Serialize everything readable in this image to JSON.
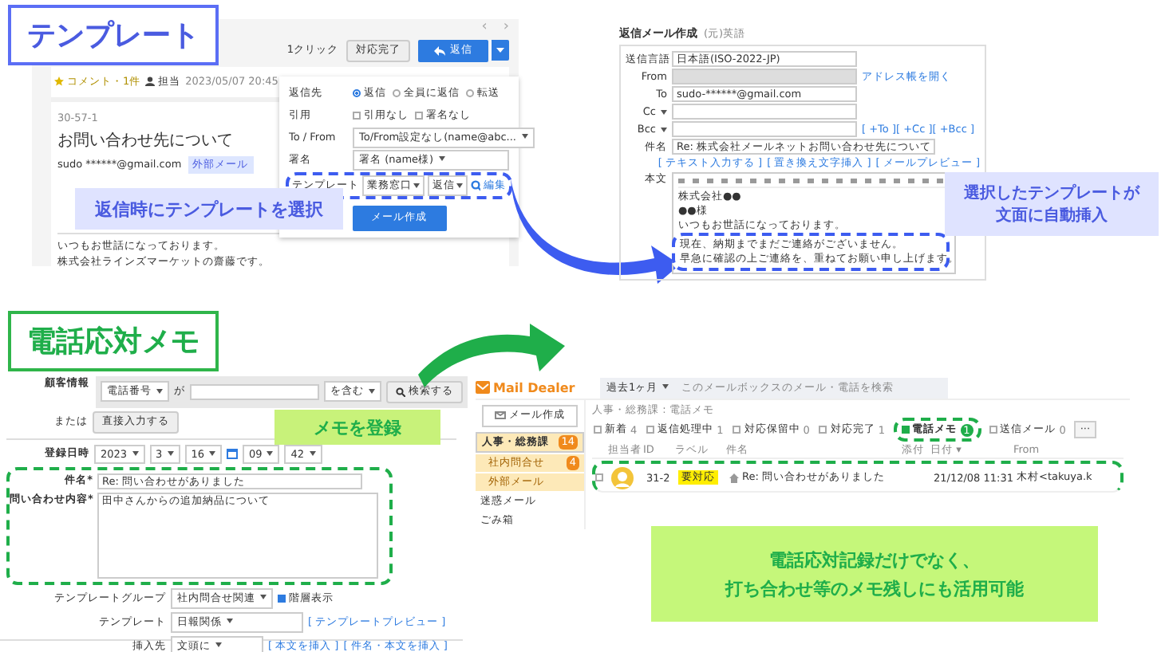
{
  "template_section": {
    "heading": "テンプレート",
    "reply_screen": {
      "nav": [
        "‹",
        "›"
      ],
      "one_click": "1クリック",
      "done_button": "対応完了",
      "reply_button": "返信",
      "comment": "コメント・1件",
      "assignee": "担当",
      "date": "2023/05/07 20:45",
      "mail_id": "30-57-1",
      "subject": "お問い合わせ先について",
      "sender": "sudo ******@gmail.com",
      "tag": "外部メール",
      "body": [
        "いつもお世話になっております。",
        "株式会社ラインズマーケットの齋藤です。"
      ],
      "reply_menu": {
        "rows": [
          {
            "label": "返信先",
            "kind": "radio",
            "options": [
              {
                "label": "返信",
                "selected": true
              },
              {
                "label": "全員に返信",
                "selected": false
              },
              {
                "label": "転送",
                "selected": false
              }
            ]
          },
          {
            "label": "引用",
            "kind": "check",
            "options": [
              {
                "label": "引用なし",
                "checked": false
              },
              {
                "label": "署名なし",
                "checked": false
              }
            ]
          },
          {
            "label": "To / From",
            "kind": "select",
            "value": "To/From設定なし(name@abc..."
          },
          {
            "label": "署名",
            "kind": "select",
            "value": "署名 (name様)"
          },
          {
            "label": "テンプレート",
            "kind": "template",
            "values": [
              "業務窓口",
              "返信"
            ],
            "edit": "編集"
          }
        ],
        "create_button": "メール作成"
      }
    },
    "reply_callout": "返信時にテンプレートを選択",
    "compose_screen": {
      "title": "返信メール作成",
      "subtitle": "(元)英語",
      "fields": [
        {
          "label": "送信言語",
          "value": "日本語(ISO-2022-JP)"
        },
        {
          "label": "From"
        },
        {
          "label": "To",
          "value": "sudo-******@gmail.com"
        },
        {
          "label": "Cc"
        },
        {
          "label": "Bcc"
        },
        {
          "label": "件名",
          "value": "Re: 株式会社メールネットお問い合わせ先について"
        }
      ],
      "address_link": "アドレス帳を開く",
      "cc_links": "[ +To ][ +Cc ][ +Bcc ]",
      "body_links": [
        "[ テキスト入力する ]",
        "[ 置き換え文字挿入 ]",
        "[ メールプレビュー ]"
      ],
      "body_label": "本文",
      "body_lines": [
        "株式会社●●",
        "●●様",
        "いつもお世話になっております。",
        "現在、納期までまだご連絡がございません。",
        "早急に確認の上ご連絡を、重ねてお願い申し上げます。"
      ]
    },
    "compose_callout": [
      "選択したテンプレートが",
      "文面に自動挿入"
    ]
  },
  "phone_memo_section": {
    "heading": "電話応対メモ",
    "memo_form": {
      "customer_label": "顧客情報",
      "search_field": "電話番号",
      "ga": "が",
      "match": "を含む",
      "search_button": "検索する",
      "or": "または",
      "direct_button": "直接入力する",
      "date_label": "登録日時",
      "date_parts": [
        "2023",
        "3",
        "16",
        "09",
        "42"
      ],
      "subject_label": "件名*",
      "subject": "Re: 問い合わせがありました",
      "content_label": "問い合わせ内容*",
      "content": "田中さんからの追加納品について",
      "group_label": "テンプレートグループ",
      "group": "社内問合せ関連",
      "hierarchy": {
        "label": "階層表示",
        "checked": true
      },
      "template_label": "テンプレート",
      "template": "日報関係",
      "preview_link": "[ テンプレートプレビュー ]",
      "insert_label": "挿入先",
      "insert": "文頭に",
      "insert_links": [
        "[ 本文を挿入 ]",
        "[ 件名・本文を挿入 ]"
      ]
    },
    "memo_callout": "メモを登録",
    "mail_app": {
      "logo": "Mail Dealer",
      "period": "過去1ヶ月",
      "search_placeholder": "このメールボックスのメール・電話を検索",
      "compose_button": "メール作成",
      "folders": [
        {
          "label": "人事・総務課",
          "count": "14",
          "selected": true,
          "children": [
            {
              "label": "社内問合せ",
              "count": "4",
              "selected": false
            },
            {
              "label": "外部メール",
              "selected": false
            }
          ]
        },
        {
          "label": "迷惑メール",
          "selected": false
        },
        {
          "label": "ごみ箱",
          "selected": false
        }
      ],
      "breadcrumb": "人事・総務課 : 電話メモ",
      "filters": [
        {
          "label": "新着",
          "count": "4",
          "selected": false
        },
        {
          "label": "返信処理中",
          "count": "1",
          "selected": false
        },
        {
          "label": "対応保留中",
          "count": "0",
          "selected": false
        },
        {
          "label": "対応完了",
          "count": "1",
          "selected": false
        },
        {
          "label": "電話メモ",
          "count": "1",
          "selected": true
        },
        {
          "label": "送信メール",
          "count": "0",
          "selected": false
        }
      ],
      "more": "···",
      "columns": [
        "担当者",
        "ID",
        "ラベル",
        "件名",
        "添付",
        "日付 ▾",
        "From"
      ],
      "rows": [
        {
          "checked": false,
          "id": "31-2",
          "label": "要対応",
          "subject": "Re: 問い合わせがありました",
          "date": "21/12/08 11:31",
          "from": "木村<takuya.k"
        }
      ]
    },
    "bottom_callout": [
      "電話応対記録だけでなく、",
      "打ち合わせ等のメモ残しにも活用可能"
    ]
  }
}
